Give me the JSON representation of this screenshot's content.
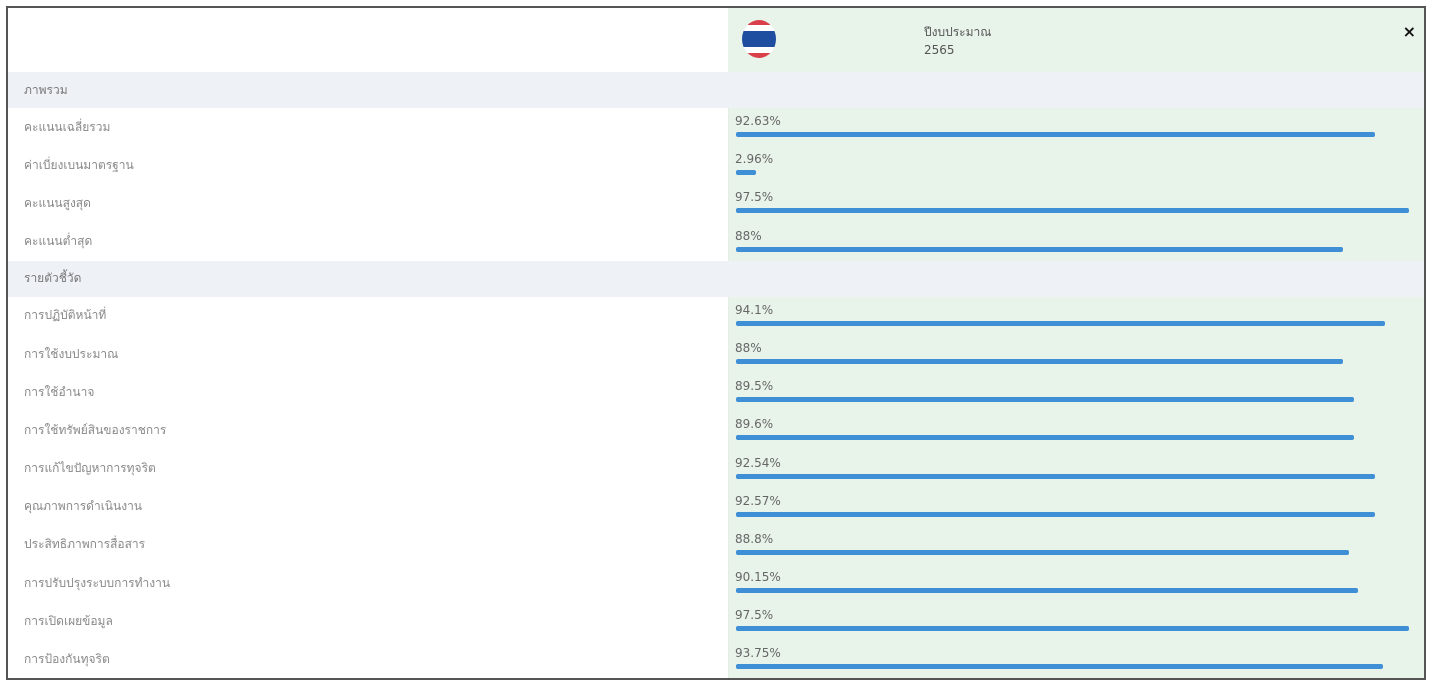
{
  "header": {
    "year_label": "ปีงบประมาณ",
    "year_value": "2565",
    "close_label": "×"
  },
  "colors": {
    "bar": "#3f8fd6",
    "panel": "#e8f3ea",
    "section": "#eef2f6"
  },
  "sections": [
    {
      "title": "ภาพรวม",
      "rows": [
        {
          "label": "คะแนนเฉลี่ยรวม",
          "value_text": "92.63%",
          "value": 92.63
        },
        {
          "label": "ค่าเบี่ยงเบนมาตรฐาน",
          "value_text": "2.96%",
          "value": 2.96
        },
        {
          "label": "คะแนนสูงสุด",
          "value_text": "97.5%",
          "value": 97.5
        },
        {
          "label": "คะแนนต่ำสุด",
          "value_text": "88%",
          "value": 88
        }
      ]
    },
    {
      "title": "รายตัวชี้วัด",
      "rows": [
        {
          "label": "การปฏิบัติหน้าที่",
          "value_text": "94.1%",
          "value": 94.1
        },
        {
          "label": "การใช้งบประมาณ",
          "value_text": "88%",
          "value": 88
        },
        {
          "label": "การใช้อำนาจ",
          "value_text": "89.5%",
          "value": 89.5
        },
        {
          "label": "การใช้ทรัพย์สินของราชการ",
          "value_text": "89.6%",
          "value": 89.6
        },
        {
          "label": "การแก้ไขปัญหาการทุจริต",
          "value_text": "92.54%",
          "value": 92.54
        },
        {
          "label": "คุณภาพการดำเนินงาน",
          "value_text": "92.57%",
          "value": 92.57
        },
        {
          "label": "ประสิทธิภาพการสื่อสาร",
          "value_text": "88.8%",
          "value": 88.8
        },
        {
          "label": "การปรับปรุงระบบการทำงาน",
          "value_text": "90.15%",
          "value": 90.15
        },
        {
          "label": "การเปิดเผยข้อมูล",
          "value_text": "97.5%",
          "value": 97.5
        },
        {
          "label": "การป้องกันทุจริต",
          "value_text": "93.75%",
          "value": 93.75
        }
      ]
    }
  ]
}
